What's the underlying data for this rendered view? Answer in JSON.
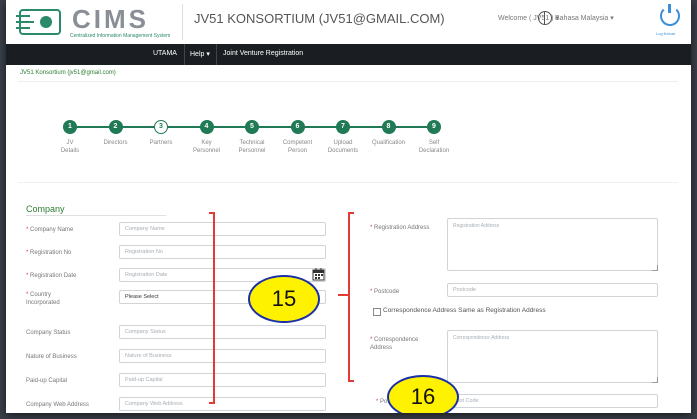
{
  "header": {
    "logo_text": "CIMS",
    "logo_subtitle": "Centralized Information Management System",
    "org_title": "JV51 KONSORTIUM (JV51@GMAIL.COM)",
    "welcome": "Welcome ( JV51 ) ▾",
    "language": "Bahasa Malaysia ▾",
    "logout_label": "Log Keluar"
  },
  "nav": {
    "home": "UTAMA",
    "help": "Help ▾",
    "jv_registration": "Joint Venture Registration"
  },
  "breadcrumb": "JV51 Konsortium (jv51@gmail.com)",
  "steps": [
    {
      "num": "1",
      "label": "JV\nDetails",
      "state": "done"
    },
    {
      "num": "2",
      "label": "Directors",
      "state": "done"
    },
    {
      "num": "3",
      "label": "Partners",
      "state": "current"
    },
    {
      "num": "4",
      "label": "Key\nPersonnel",
      "state": "done"
    },
    {
      "num": "5",
      "label": "Technical\nPersonnel",
      "state": "done"
    },
    {
      "num": "6",
      "label": "Competent\nPerson",
      "state": "done"
    },
    {
      "num": "7",
      "label": "Upload\nDocuments",
      "state": "done"
    },
    {
      "num": "8",
      "label": "Qualification",
      "state": "done"
    },
    {
      "num": "9",
      "label": "Self\nDeclaration",
      "state": "done"
    }
  ],
  "section_title": "Company",
  "left_fields": [
    {
      "label": "Company Name",
      "required": true,
      "placeholder": "Company Name"
    },
    {
      "label": "Registration No",
      "required": true,
      "placeholder": "Registration No"
    },
    {
      "label": "Registration Date",
      "required": true,
      "placeholder": "Registration Date"
    },
    {
      "label": "Country\nIncorporated",
      "required": true,
      "placeholder": "Please Select"
    },
    {
      "label": "Company Status",
      "required": false,
      "placeholder": "Company Status"
    },
    {
      "label": "Nature of Business",
      "required": false,
      "placeholder": "Nature of Business"
    },
    {
      "label": "Paid-up Capital",
      "required": false,
      "placeholder": "Paid-up Capital"
    },
    {
      "label": "Company Web Address",
      "required": false,
      "placeholder": "Company Web Address"
    }
  ],
  "right_fields": {
    "registration_address": {
      "label": "Registration Address",
      "placeholder": "Registration Address"
    },
    "postcode": {
      "label": "Postcode",
      "placeholder": "Postcode"
    },
    "same_as_checkbox": "Correspondence Address Same as Registration Address",
    "correspondence_address": {
      "label": "Correspondence\nAddress",
      "placeholder": "Correspondence Address"
    },
    "postcode2": {
      "label": "Po",
      "placeholder": "Post Code"
    }
  },
  "annotations": {
    "left": "15",
    "right": "16"
  },
  "colors": {
    "accent": "#1f7a55",
    "nav_bg": "#1a1d21",
    "annotation_fill": "#fff200",
    "annotation_border": "#1a2fa8",
    "bracket": "#e53935"
  }
}
